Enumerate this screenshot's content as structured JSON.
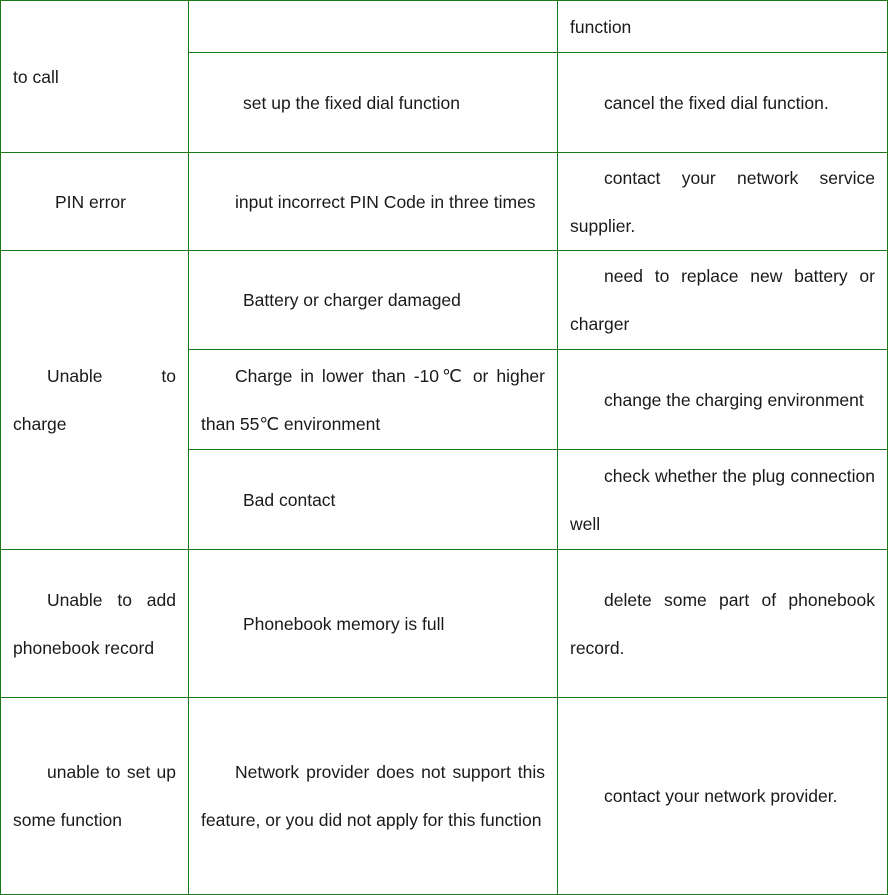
{
  "document": {
    "type": "troubleshooting-table",
    "border_color": "#1a7a1a",
    "text_color": "#1a1a1a",
    "background": "#ffffff"
  },
  "table": {
    "column_count": 3,
    "rows": [
      {
        "id": "row-to-call-1",
        "cause": "",
        "solution": "function",
        "symptom": "to call",
        "symptom_rowspan": 2
      },
      {
        "id": "row-to-call-2",
        "cause": "set up the fixed dial function",
        "solution": "cancel the fixed dial function."
      },
      {
        "id": "row-pin-error",
        "symptom": "PIN error",
        "cause": "input incorrect PIN Code in three times",
        "solution": "contact your network service supplier."
      },
      {
        "id": "row-unable-charge-1",
        "symptom": "Unable to charge",
        "symptom_rowspan": 3,
        "cause": "Battery or charger damaged",
        "solution": "need to replace new battery or charger"
      },
      {
        "id": "row-unable-charge-2",
        "cause": "Charge in lower than -10℃ or higher than 55℃ environment",
        "solution": "change the charging environment"
      },
      {
        "id": "row-unable-charge-3",
        "cause": "Bad contact",
        "solution": "check whether the plug connection well"
      },
      {
        "id": "row-phonebook",
        "symptom": "Unable to add phonebook record",
        "cause": "Phonebook memory is full",
        "solution": "delete some part of phonebook record."
      },
      {
        "id": "row-setup-function",
        "symptom": "unable to set up some function",
        "cause": "Network provider does not support this feature, or you did not apply for this function",
        "solution": "contact your network provider."
      }
    ]
  }
}
